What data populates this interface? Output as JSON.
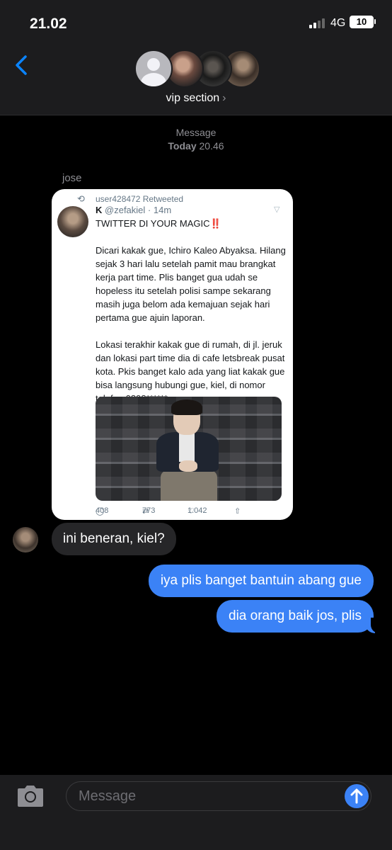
{
  "status_bar": {
    "time": "21.02",
    "network": "4G",
    "battery": "10"
  },
  "header": {
    "group_name": "vip section",
    "chevron": "›"
  },
  "conversation": {
    "service": "Message",
    "day": "Today",
    "time": "20.46",
    "sender": "jose"
  },
  "tweet": {
    "retweet_by": "user428472 Retweeted",
    "author_name": "K",
    "handle": "@zefakiel",
    "age": "14m",
    "body": "TWITTER DI YOUR MAGIC‼️\n\nDicari kakak gue, Ichiro Kaleo Abyaksa. Hilang sejak 3 hari lalu setelah pamit mau brangkat kerja part time. Plis banget gua udah se hopeless itu setelah polisi sampe sekarang masih juga belom ada kemajuan sejak hari pertama gue ajuin laporan.\n\nLokasi terakhir kakak gue di rumah, di jl. jeruk dan lokasi part time dia di cafe letsbreak pusat kota. Pkis banget kalo ada yang liat kakak gue bisa langsung hubungi gue, kiel, di nomor telefon 0898******",
    "replies": "408",
    "retweets": "773",
    "likes": "1.042"
  },
  "messages": {
    "incoming_1": "ini beneran, kiel?",
    "outgoing_1": "iya plis banget bantuin abang gue",
    "outgoing_2": "dia orang baik jos, plis"
  },
  "composer": {
    "placeholder": "Message"
  },
  "colors": {
    "accent": "#3b82f6",
    "bubble_incoming": "#262628",
    "chrome": "#1c1c1e"
  },
  "icons": [
    "back-chevron-icon",
    "camera-icon",
    "send-arrow-icon",
    "retweet-icon",
    "reply-icon",
    "like-icon",
    "share-icon"
  ]
}
